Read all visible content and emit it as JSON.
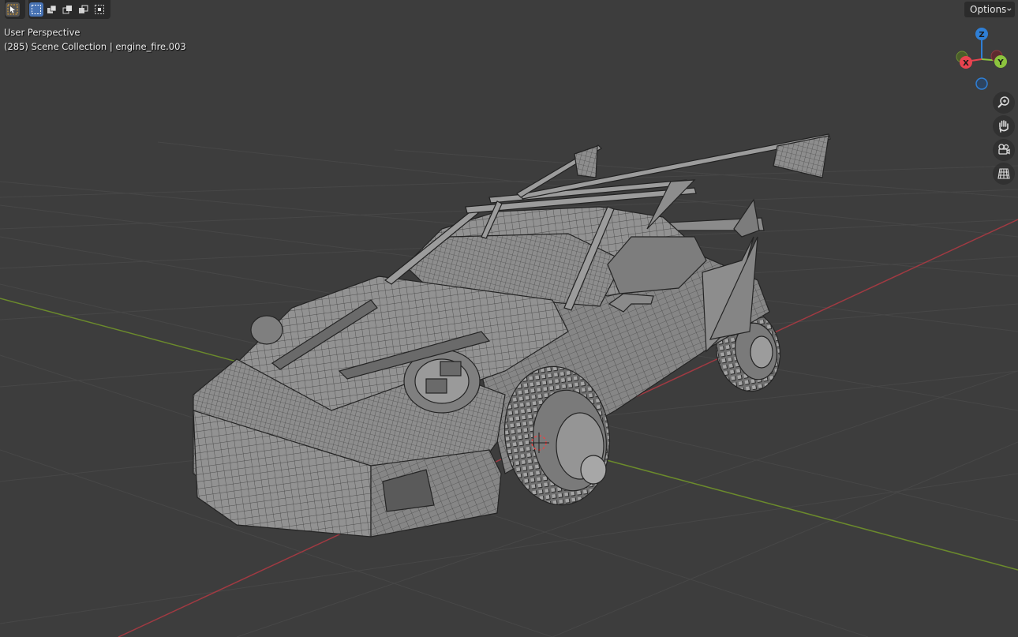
{
  "viewport": {
    "perspective_label": "User Perspective",
    "collection_label": "(285) Scene Collection | engine_fire.003"
  },
  "header": {
    "tools": [
      {
        "name": "select-tweak",
        "icon": "cursor-select-icon",
        "active": false
      },
      {
        "name": "select-box-new",
        "icon": "select-box-icon",
        "active": true
      },
      {
        "name": "select-box-extend",
        "icon": "select-extend-icon",
        "active": false
      },
      {
        "name": "select-box-subtract",
        "icon": "select-subtract-icon",
        "active": false
      },
      {
        "name": "select-box-invert",
        "icon": "select-invert-icon",
        "active": false
      },
      {
        "name": "select-box-intersect",
        "icon": "select-intersect-icon",
        "active": false
      }
    ],
    "options_label": "Options"
  },
  "gizmo": {
    "axes": [
      {
        "label": "Z",
        "color": "#2f7fd6"
      },
      {
        "label": "Y",
        "color": "#8cc43e"
      },
      {
        "label": "X",
        "color": "#e8434f"
      }
    ]
  },
  "navigation": [
    {
      "name": "zoom",
      "icon": "zoom-icon"
    },
    {
      "name": "pan",
      "icon": "hand-pan-icon"
    },
    {
      "name": "camera",
      "icon": "camera-view-icon"
    },
    {
      "name": "ortho",
      "icon": "grid-ortho-icon"
    }
  ],
  "colors": {
    "background": "#3d3d3d",
    "grid": "#484848",
    "x_axis": "#a03a42",
    "y_axis": "#6b8a2c",
    "mesh_fill": "#8f8f8f",
    "wire": "#2a2a2a"
  }
}
